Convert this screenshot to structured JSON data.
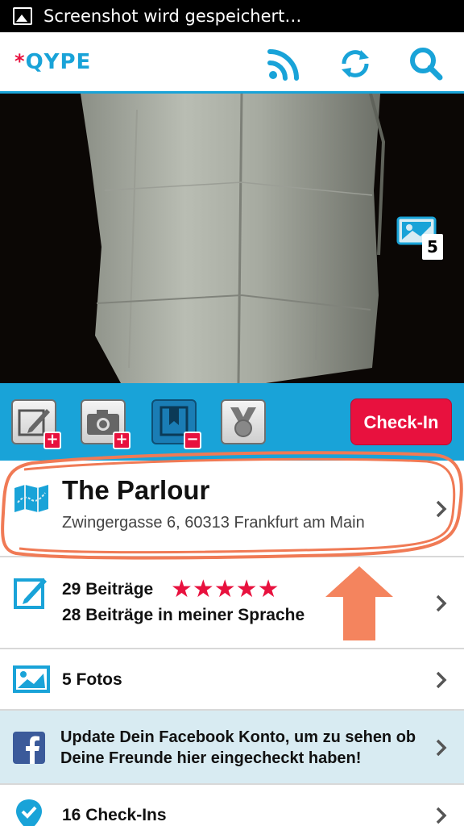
{
  "status_bar": {
    "notification_icon": "image-icon",
    "text": "Screenshot wird gespeichert…"
  },
  "app_bar": {
    "logo_text": "QYPE",
    "logo_star": "*",
    "actions": [
      "rss-icon",
      "sync-icon",
      "search-icon"
    ],
    "accent_color": "#19a3d8"
  },
  "photo": {
    "gallery_count": "5"
  },
  "actions": {
    "review": "write-review-icon",
    "photo": "add-photo-icon",
    "bookmark": "bookmark-remove-icon",
    "badge": "badge-icon",
    "checkin_label": "Check-In",
    "checkin_color": "#e8113e"
  },
  "place": {
    "name": "The Parlour",
    "address": "Zwingergasse 6, 60313 Frankfurt am Main"
  },
  "reviews": {
    "count_label": "29 Beiträge",
    "rating": 5,
    "stars": "★★★★★",
    "language_label": "28 Beiträge in meiner Sprache"
  },
  "photos": {
    "label": "5 Fotos"
  },
  "facebook": {
    "text": "Update Dein Facebook Konto, um zu sehen ob Deine Freunde hier eingecheckt haben!"
  },
  "checkins": {
    "label": "16 Check-Ins"
  }
}
